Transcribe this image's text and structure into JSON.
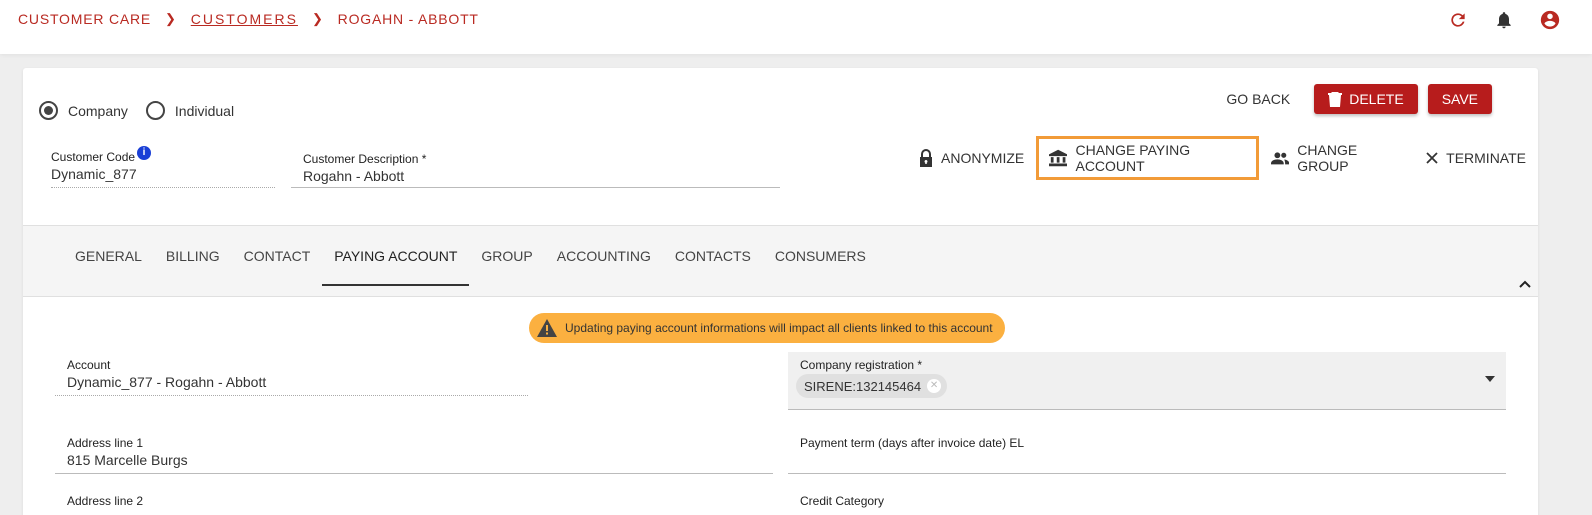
{
  "breadcrumb": {
    "root": "CUSTOMER CARE",
    "section": "CUSTOMERS",
    "current": "ROGAHN - ABBOTT"
  },
  "header_icons": [
    "refresh-icon",
    "bell-icon",
    "account-circle-icon"
  ],
  "colors": {
    "brand_red": "#b71c1c",
    "breadcrumb_red": "#b92a22",
    "highlight_orange": "#f29b38",
    "warning_yellow": "#fbb040",
    "info_blue": "#1a3fd6"
  },
  "customer_type": {
    "options": [
      "Company",
      "Individual"
    ],
    "selected": "Company"
  },
  "fields": {
    "customer_code": {
      "label": "Customer Code",
      "value": "Dynamic_877",
      "info": "i"
    },
    "customer_description": {
      "label": "Customer Description *",
      "value": "Rogahn - Abbott"
    }
  },
  "top_actions": {
    "go_back": "GO BACK",
    "delete": "DELETE",
    "save": "SAVE"
  },
  "actions": {
    "anonymize": "ANONYMIZE",
    "change_paying_account": "CHANGE PAYING ACCOUNT",
    "change_group": "CHANGE GROUP",
    "terminate": "TERMINATE"
  },
  "tabs": [
    {
      "label": "GENERAL",
      "active": false
    },
    {
      "label": "BILLING",
      "active": false
    },
    {
      "label": "CONTACT",
      "active": false
    },
    {
      "label": "PAYING ACCOUNT",
      "active": true
    },
    {
      "label": "GROUP",
      "active": false
    },
    {
      "label": "ACCOUNTING",
      "active": false
    },
    {
      "label": "CONTACTS",
      "active": false
    },
    {
      "label": "CONSUMERS",
      "active": false
    }
  ],
  "warning": "Updating paying account informations will impact all clients linked to this account",
  "paying_account": {
    "account": {
      "label": "Account",
      "value": "Dynamic_877 - Rogahn - Abbott"
    },
    "company_registration": {
      "label": "Company registration *",
      "chip": "SIRENE:132145464"
    },
    "address_line_1": {
      "label": "Address line 1",
      "value": "815 Marcelle Burgs"
    },
    "payment_term": {
      "label": "Payment term (days after invoice date) EL",
      "value": ""
    },
    "address_line_2": {
      "label": "Address line 2",
      "value": ""
    },
    "credit_category": {
      "label": "Credit Category",
      "value": ""
    }
  }
}
